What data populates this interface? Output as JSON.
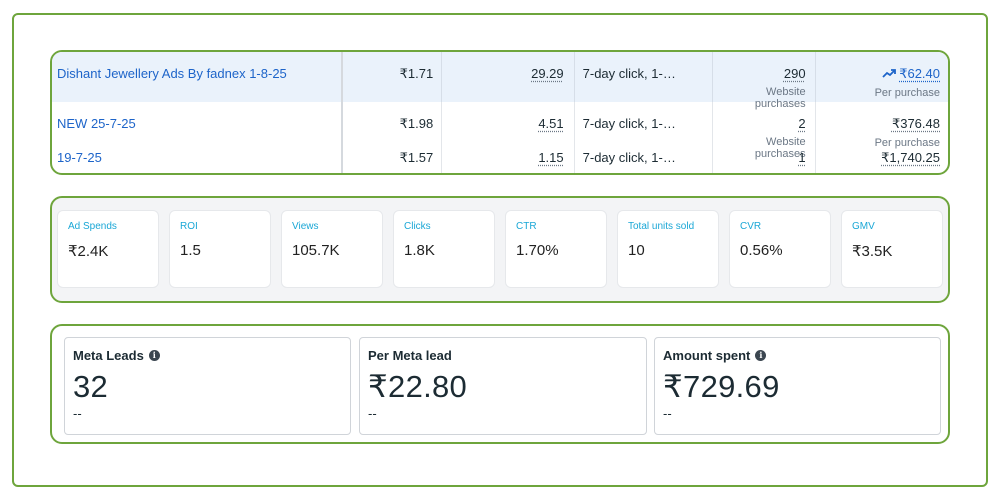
{
  "ads_table": {
    "rows": [
      {
        "name": "Dishant Jewellery Ads By fadnex 1-8-25",
        "cost": "₹1.71",
        "frequency": "29.29",
        "attribution": "7-day click, 1-…",
        "results": "290",
        "results_label": "Website purchases",
        "cost_per_result": "₹62.40",
        "cost_per_result_label": "Per purchase",
        "trend_icon": "trending-up-icon"
      },
      {
        "name": "NEW 25-7-25",
        "cost": "₹1.98",
        "frequency": "4.51",
        "attribution": "7-day click, 1-…",
        "results": "2",
        "results_label": "Website purchases",
        "cost_per_result": "₹376.48",
        "cost_per_result_label": "Per purchase"
      },
      {
        "name": "19-7-25",
        "cost": "₹1.57",
        "frequency": "1.15",
        "attribution": "7-day click, 1-…",
        "results": "1",
        "cost_per_result": "₹1,740.25"
      }
    ]
  },
  "kpis": [
    {
      "label": "Ad Spends",
      "value": "₹2.4K"
    },
    {
      "label": "ROI",
      "value": "1.5"
    },
    {
      "label": "Views",
      "value": "105.7K"
    },
    {
      "label": "Clicks",
      "value": "1.8K"
    },
    {
      "label": "CTR",
      "value": "1.70%"
    },
    {
      "label": "Total units sold",
      "value": "10"
    },
    {
      "label": "CVR",
      "value": "0.56%"
    },
    {
      "label": "GMV",
      "value": "₹3.5K"
    }
  ],
  "meta_cards": [
    {
      "title": "Meta Leads",
      "value": "32",
      "sub": "--",
      "has_info": true
    },
    {
      "title": "Per Meta lead",
      "value": "₹22.80",
      "sub": "--",
      "has_info": false
    },
    {
      "title": "Amount spent",
      "value": "₹729.69",
      "sub": "--",
      "has_info": true
    }
  ],
  "colors": {
    "highlight_border": "#6ea53c",
    "link": "#1d64c9",
    "kpi_label": "#1aa7d6",
    "selected_row": "#eaf2fb"
  }
}
